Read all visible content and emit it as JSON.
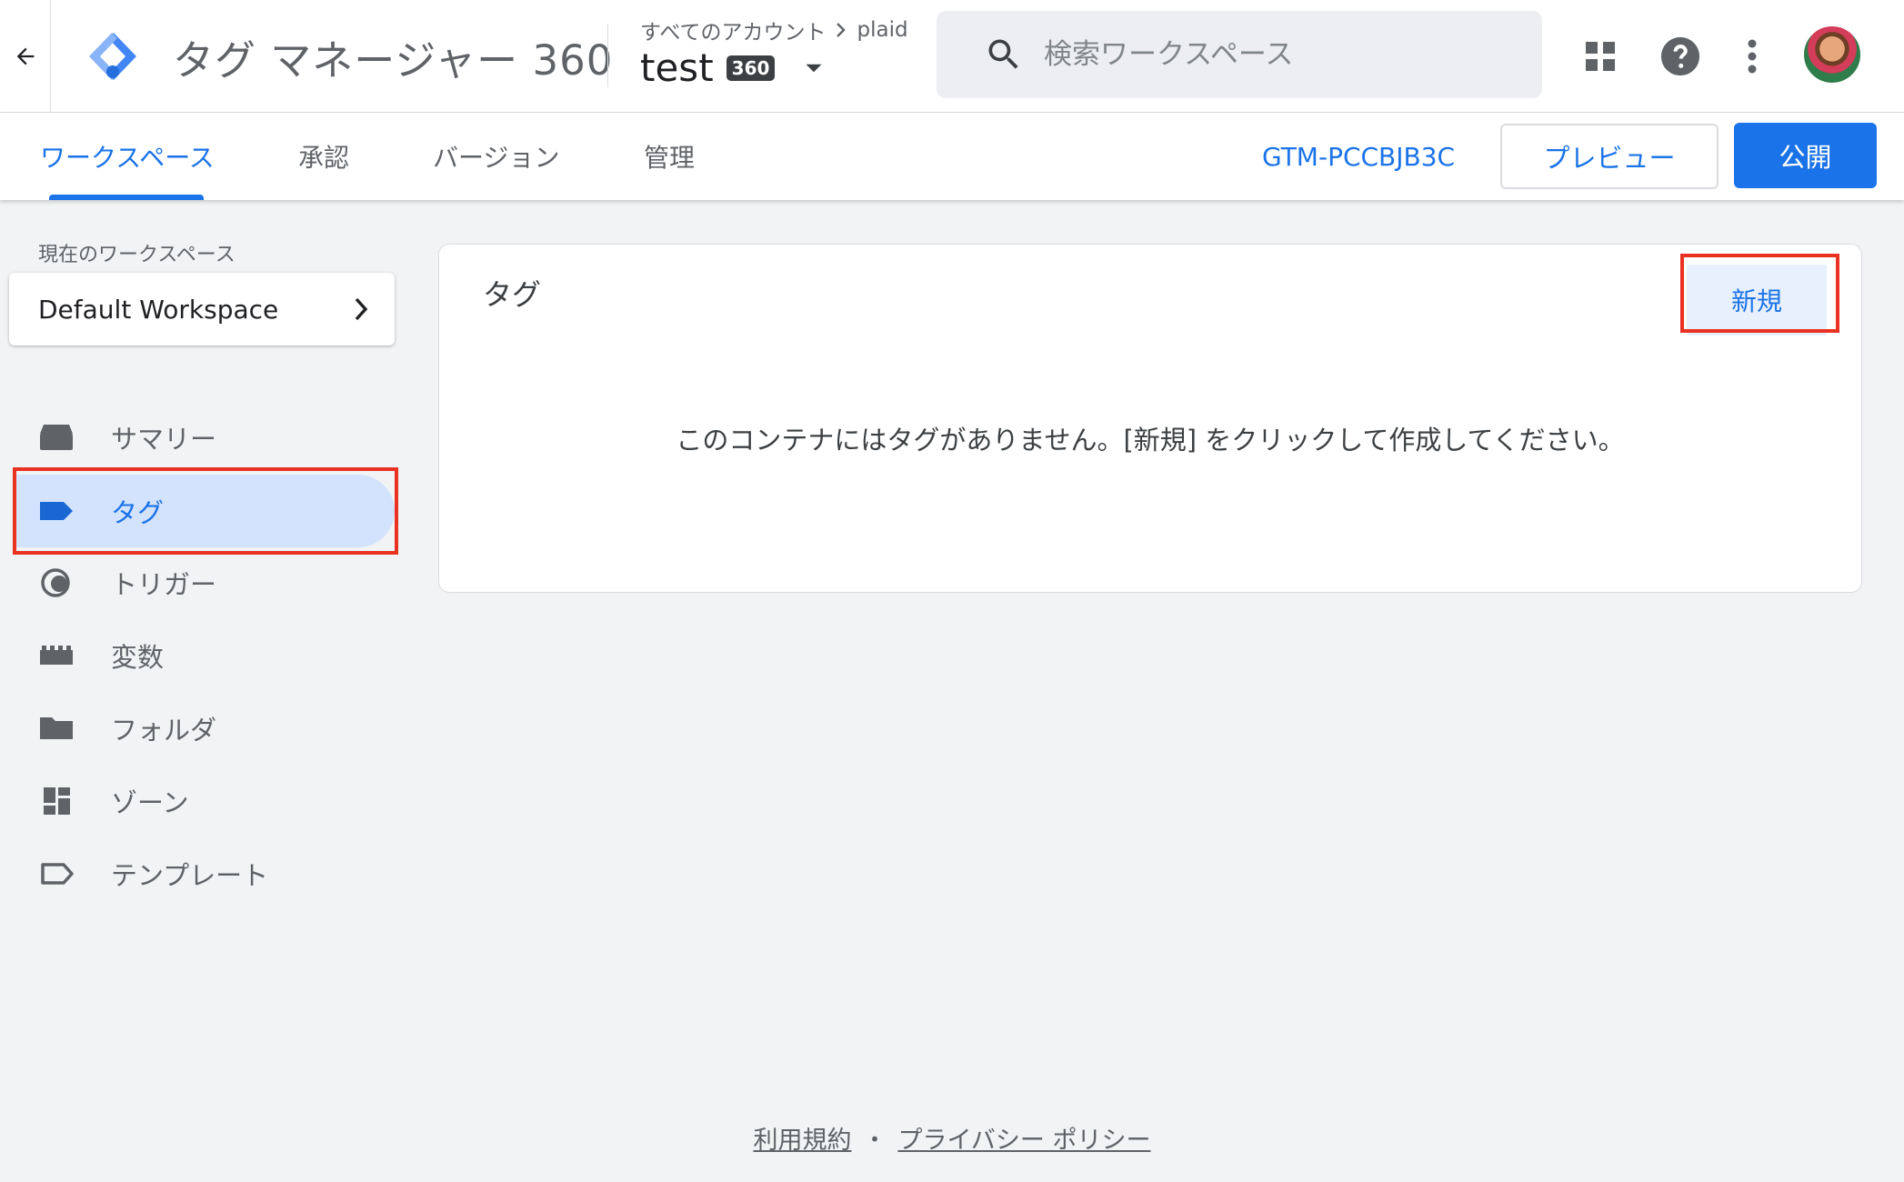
{
  "header": {
    "app_title": "タグ マネージャー 360",
    "breadcrumb_all": "すべてのアカウント",
    "breadcrumb_account": "plaid",
    "container_name": "test",
    "container_badge": "360",
    "search_placeholder": "検索ワークスペース"
  },
  "nav": {
    "tabs": [
      {
        "label": "ワークスペース",
        "active": true
      },
      {
        "label": "承認",
        "active": false
      },
      {
        "label": "バージョン",
        "active": false
      },
      {
        "label": "管理",
        "active": false
      }
    ],
    "container_id": "GTM-PCCBJB3C",
    "preview_label": "プレビュー",
    "publish_label": "公開"
  },
  "sidebar": {
    "workspace_heading": "現在のワークスペース",
    "workspace_name": "Default Workspace",
    "items": [
      {
        "label": "サマリー",
        "icon": "summary-icon",
        "active": false
      },
      {
        "label": "タグ",
        "icon": "tag-icon",
        "active": true
      },
      {
        "label": "トリガー",
        "icon": "trigger-icon",
        "active": false
      },
      {
        "label": "変数",
        "icon": "variable-icon",
        "active": false
      },
      {
        "label": "フォルダ",
        "icon": "folder-icon",
        "active": false
      },
      {
        "label": "ゾーン",
        "icon": "zone-icon",
        "active": false
      },
      {
        "label": "テンプレート",
        "icon": "template-icon",
        "active": false
      }
    ]
  },
  "main": {
    "panel_title": "タグ",
    "new_label": "新規",
    "empty_message": "このコンテナにはタグがありません。[新規] をクリックして作成してください。"
  },
  "footer": {
    "terms": "利用規約",
    "separator": "・",
    "privacy": "プライバシー ポリシー"
  },
  "colors": {
    "accent": "#1a73e8",
    "highlight_box": "#ea3223",
    "active_item_bg": "#d3e3fd",
    "page_bg": "#f1f3f4"
  }
}
